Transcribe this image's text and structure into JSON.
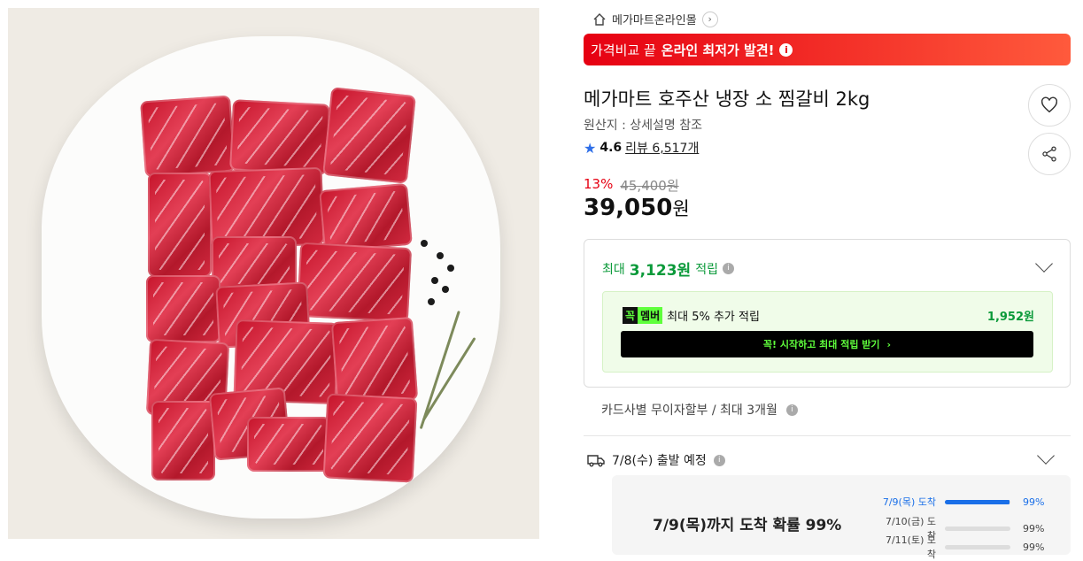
{
  "product_image": {
    "alt": ""
  },
  "breadcrumb": {
    "label": "메가마트온라인몰",
    "arrow": "›",
    "icon": "home-icon"
  },
  "banner": {
    "prefix": "가격비교 끝",
    "highlight": "온라인 최저가 발견!",
    "info": "i"
  },
  "product": {
    "title": "메가마트 호주산 냉장 소 찜갈비 2kg",
    "origin": "원산지 : 상세설명 참조",
    "rating": "4.6",
    "reviews": "리뷰 6,517개"
  },
  "actions": {
    "wishlist_icon": "heart-icon",
    "share_icon": "share-icon"
  },
  "pricing": {
    "discount_rate": "13%",
    "original_price": "45,400원",
    "price": "39,050",
    "currency": "원"
  },
  "rewards": {
    "prefix": "최대",
    "amount": "3,123원",
    "suffix": "적립",
    "info": "i",
    "member": {
      "badge_a": "꼭",
      "badge_b": "멤버",
      "text": "최대 5% 추가 적립",
      "amount": "1,952원",
      "button": "꼭! 시작하고 최대 적립 받기",
      "button_arrow": "›"
    }
  },
  "installment": {
    "text": "카드사별 무이자할부 / 최대 3개월",
    "info": "i"
  },
  "shipping": {
    "label": "7/8(수) 출발 예정",
    "info": "i",
    "probability": "7/9(목)까지 도착 확률 99%",
    "rows": [
      {
        "date": "7/9(목) 도착",
        "pct": "99%",
        "fill": 0.99
      },
      {
        "date": "7/10(금) 도착",
        "pct": "99%",
        "fill": 0.0
      },
      {
        "date": "7/11(토) 도착",
        "pct": "99%",
        "fill": 0.0
      }
    ]
  },
  "colors": {
    "accent_red": "#e60012",
    "reward_green": "#0b9a3a",
    "link_blue": "#1a6fe8"
  }
}
